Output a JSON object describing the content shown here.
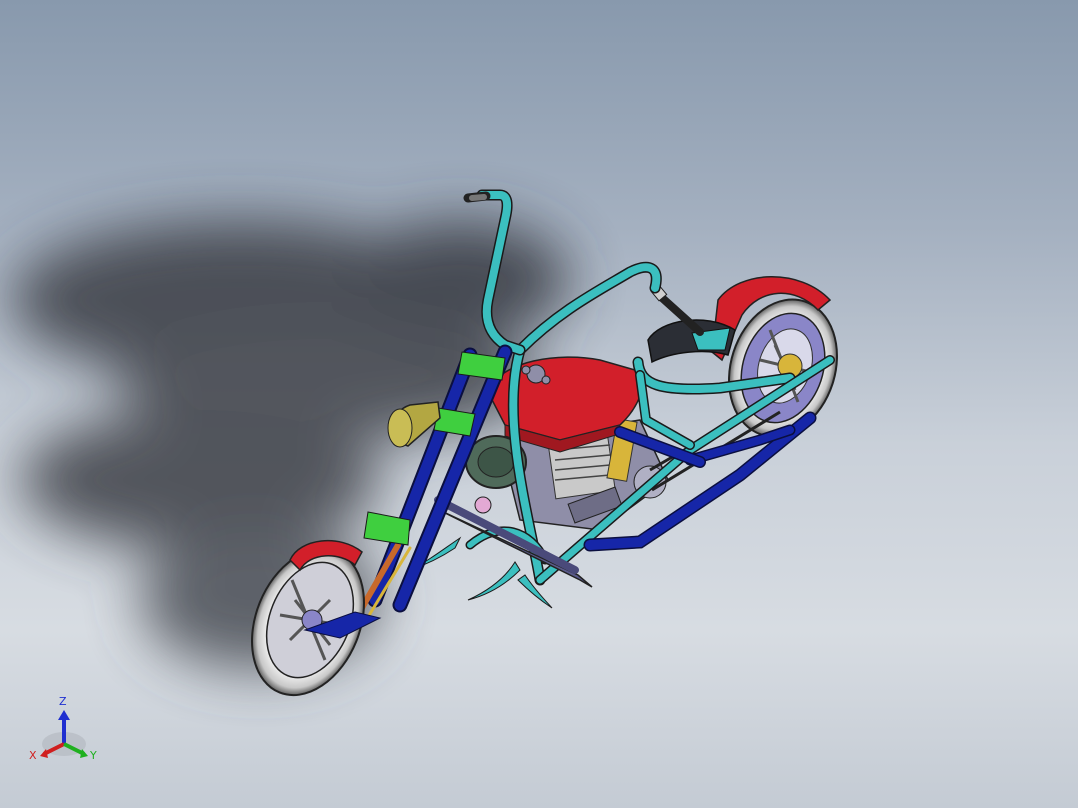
{
  "viewport": {
    "background_top": "#8899ad",
    "background_bottom": "#d7dce2"
  },
  "model": {
    "colors": {
      "frame_cyan": "#3bbfbf",
      "fork_blue": "#1626a8",
      "tank_red": "#d21f2a",
      "engine_gray": "#8f8ea8",
      "highlight_green": "#3fcf3f",
      "headlight_olive": "#b3a742",
      "tire_white": "#e8e8e8",
      "rim_lavender": "#8a86c8"
    }
  },
  "triad": {
    "z_label": "Z",
    "x_label": "X",
    "y_label": "Y",
    "z_color": "#1f2fd0",
    "x_color": "#d01f1f",
    "y_color": "#1fb01f"
  }
}
